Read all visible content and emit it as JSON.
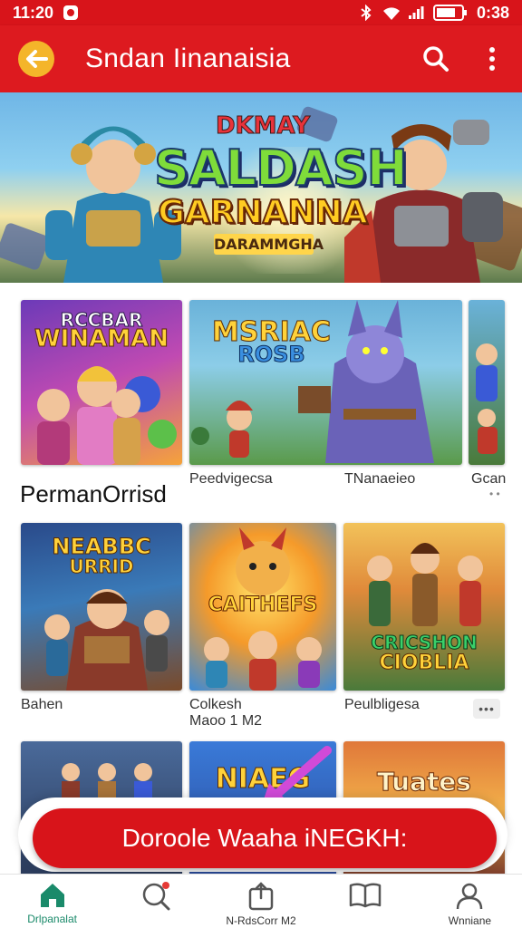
{
  "status_bar": {
    "time_left": "11:20",
    "time_right": "0:38"
  },
  "app_bar": {
    "title": "Sndan Iinanaisia"
  },
  "hero": {
    "kicker": "DKMAY",
    "title": "SALDASH",
    "subtitle": "GARNANNA",
    "tag": "DARAMMGHA"
  },
  "row1": {
    "cards": [
      {
        "art_text_1": "RCCBAR",
        "art_text_2": "WINAMAN",
        "caption": ""
      },
      {
        "art_text_1": "MSRIAC",
        "art_text_2": "ROSB",
        "caption": "Pеedvigecsa"
      },
      {
        "art_text_1": "",
        "art_text_2": "",
        "caption": "TNanaeieo"
      },
      {
        "art_text_1": "",
        "art_text_2": "",
        "caption": "Gcan"
      }
    ]
  },
  "section_title": "PermanOrrisd",
  "row2": {
    "cards": [
      {
        "art_text_1": "NEABBC",
        "art_text_2": "URRID",
        "caption": "Bahen",
        "caption2": ""
      },
      {
        "art_text_1": "CAITHEFS",
        "art_text_2": "",
        "caption": "Colkesh",
        "caption2": "Maoo 1 M2"
      },
      {
        "art_text_1": "CRICSHON",
        "art_text_2": "CIOBLIA",
        "caption": "Peulbligesa",
        "caption2": ""
      }
    ],
    "more_label": "•••"
  },
  "row3": {
    "cards": [
      {
        "art_text_1": ""
      },
      {
        "art_text_1": "NIAEG"
      },
      {
        "art_text_1": "Tuates"
      }
    ]
  },
  "cta": {
    "label": "Dorоole Waaha iNEGKH:"
  },
  "bottom_nav": {
    "items": [
      {
        "label": "Drlpanalat",
        "icon": "home-icon",
        "active": true
      },
      {
        "label": "",
        "icon": "search-chat-icon",
        "active": false
      },
      {
        "label": "N-RdsCorr M2",
        "icon": "share-icon",
        "active": false
      },
      {
        "label": "",
        "icon": "book-icon",
        "active": false
      },
      {
        "label": "Wnniane",
        "icon": "profile-icon",
        "active": false
      }
    ]
  },
  "colors": {
    "primary": "#dd1a1f",
    "accent": "#f4b52a",
    "nav_active": "#1a8a6a"
  }
}
